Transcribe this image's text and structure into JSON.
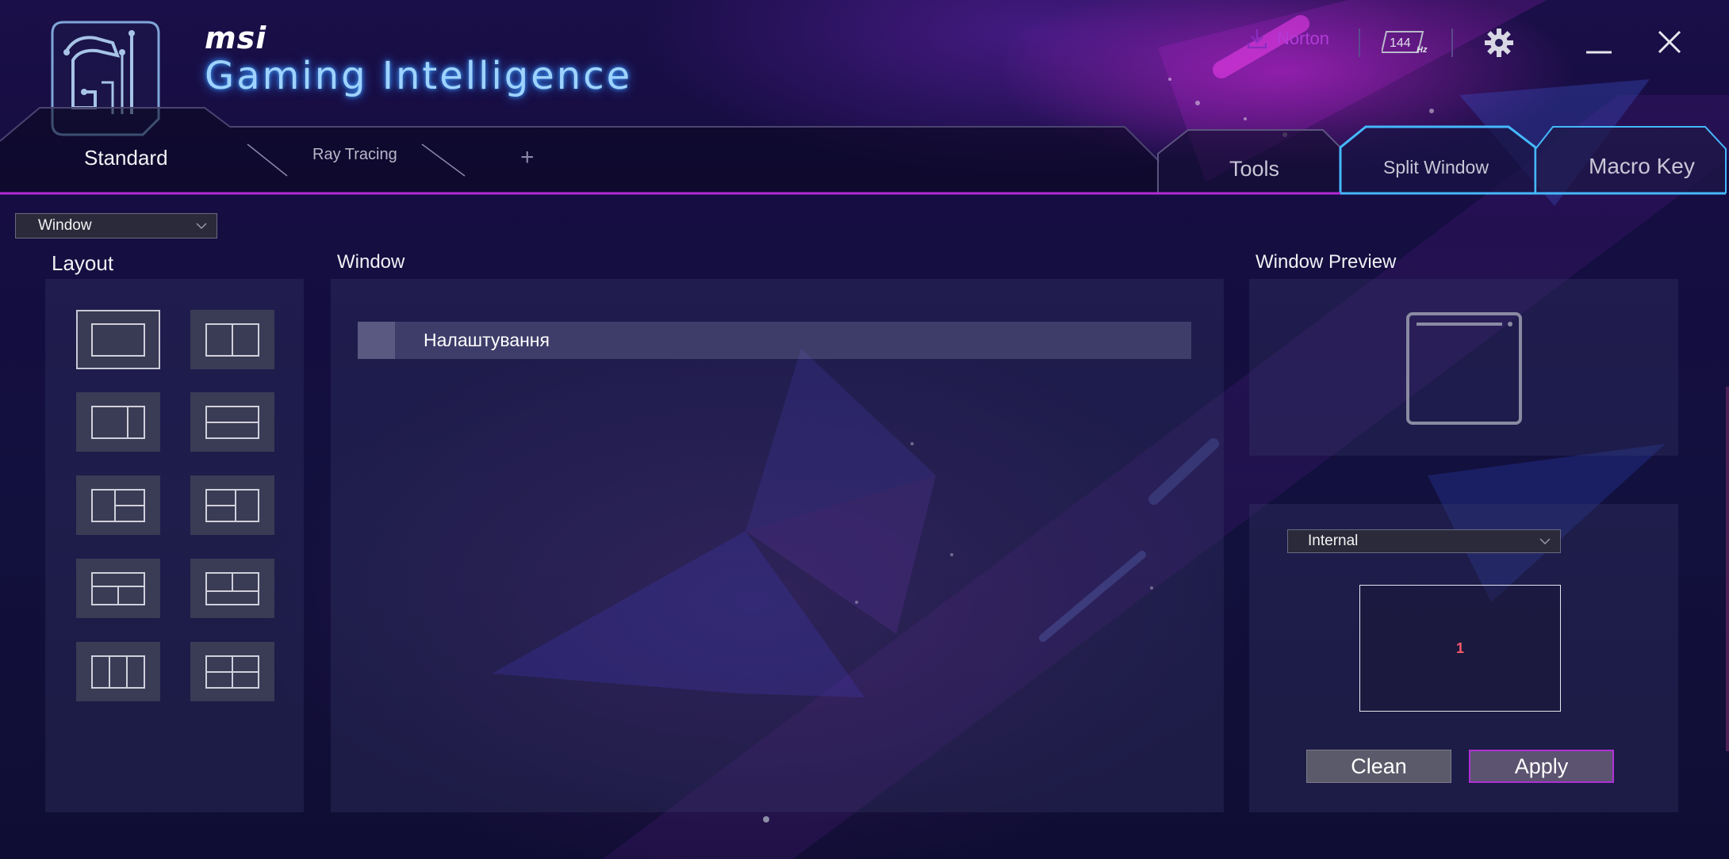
{
  "app": {
    "brand_small": "msi",
    "brand_title": "Gaming Intelligence"
  },
  "header": {
    "norton_label": "Norton",
    "refresh_rate": "144",
    "refresh_unit": "Hz",
    "icons": [
      "download-icon",
      "refresh-rate-icon",
      "gear-icon",
      "minimize-icon",
      "close-icon"
    ]
  },
  "tabs": {
    "profiles": [
      {
        "label": "Standard",
        "active": true
      },
      {
        "label": "Ray Tracing",
        "active": false
      }
    ],
    "add_label": "+",
    "features": [
      {
        "label": "Tools",
        "active": false
      },
      {
        "label": "Split Window",
        "active": true
      },
      {
        "label": "Macro Key",
        "active": false
      }
    ]
  },
  "mode_select": {
    "value": "Window"
  },
  "layout": {
    "title": "Layout",
    "options": [
      {
        "name": "single",
        "active": true
      },
      {
        "name": "two-columns",
        "active": false
      },
      {
        "name": "left-wide-right-narrow",
        "active": false
      },
      {
        "name": "two-rows",
        "active": false
      },
      {
        "name": "left-full-right-split",
        "active": false
      },
      {
        "name": "left-split-right-full",
        "active": false
      },
      {
        "name": "top-full-bottom-split",
        "active": false
      },
      {
        "name": "top-split-bottom-full",
        "active": false
      },
      {
        "name": "three-columns",
        "active": false
      },
      {
        "name": "four-grid",
        "active": false
      }
    ]
  },
  "window_list": {
    "title": "Window",
    "items": [
      {
        "label": "Налаштування"
      }
    ]
  },
  "preview": {
    "title": "Window Preview"
  },
  "monitor": {
    "select_value": "Internal",
    "zone_label": "1"
  },
  "actions": {
    "clean_label": "Clean",
    "apply_label": "Apply"
  },
  "colors": {
    "accent_magenta": "#b030d6",
    "accent_cyan": "#3ea2ff",
    "norton": "#b23bd8",
    "zone_number": "#ff5a6a"
  }
}
